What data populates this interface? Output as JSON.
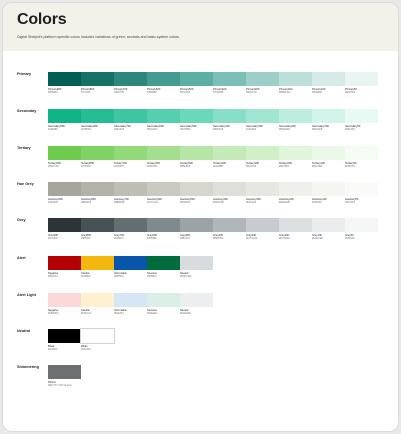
{
  "title": "Colors",
  "subtitle": "Digital Shelpid's platform specific colors includes variations of green, neutrals and basic system colors.",
  "groups": [
    {
      "label": "Primary",
      "swatches": [
        {
          "color": "#005e52",
          "name": "Primary900",
          "hex": "#005E52"
        },
        {
          "color": "#177266",
          "name": "Primary800",
          "hex": "#177266"
        },
        {
          "color": "#2e877b",
          "name": "Primary700",
          "hex": "#2E877B"
        },
        {
          "color": "#459b8f",
          "name": "Primary600",
          "hex": "#459B8F"
        },
        {
          "color": "#5cafa3",
          "name": "Primary500",
          "hex": "#5CAFA3"
        },
        {
          "color": "#7cbfb6",
          "name": "Primary400",
          "hex": "#7CBFB6"
        },
        {
          "color": "#9dcfc8",
          "name": "Primary300",
          "hex": "#9DCFC8"
        },
        {
          "color": "#bddfda",
          "name": "Primary200",
          "hex": "#BDDFDA"
        },
        {
          "color": "#d6ebe7",
          "name": "Primary100",
          "hex": "#D6EBE7"
        },
        {
          "color": "#eaf5f3",
          "name": "Primary50",
          "hex": "#EAF5F3"
        }
      ]
    },
    {
      "label": "Secondary",
      "swatches": [
        {
          "color": "#10b486",
          "name": "Secondary900",
          "hex": "#10B486"
        },
        {
          "color": "#27bd93",
          "name": "Secondary800",
          "hex": "#27BD93"
        },
        {
          "color": "#3ec6a0",
          "name": "Secondary700",
          "hex": "#3EC6A0"
        },
        {
          "color": "#55cfad",
          "name": "Secondary600",
          "hex": "#55CFAD"
        },
        {
          "color": "#6cd8ba",
          "name": "Secondary500",
          "hex": "#6CD8BA"
        },
        {
          "color": "#86dfc6",
          "name": "Secondary400",
          "hex": "#86DFC6"
        },
        {
          "color": "#a1e6d3",
          "name": "Secondary300",
          "hex": "#A1E6D3"
        },
        {
          "color": "#bcede0",
          "name": "Secondary200",
          "hex": "#BCEDE0"
        },
        {
          "color": "#d3f4eb",
          "name": "Secondary100",
          "hex": "#D3F4EB"
        },
        {
          "color": "#e9faf5",
          "name": "Secondary50",
          "hex": "#E9FAF5"
        }
      ]
    },
    {
      "label": "Tertiary",
      "swatches": [
        {
          "color": "#6dcc4d",
          "name": "Tertiary900",
          "hex": "#6DCC4D"
        },
        {
          "color": "#7fd263",
          "name": "Tertiary800",
          "hex": "#7FD263"
        },
        {
          "color": "#91d979",
          "name": "Tertiary700",
          "hex": "#91D979"
        },
        {
          "color": "#a3df8f",
          "name": "Tertiary600",
          "hex": "#A3DF8F"
        },
        {
          "color": "#b5e6a5",
          "name": "Tertiary500",
          "hex": "#B5E6A5"
        },
        {
          "color": "#c4ebb7",
          "name": "Tertiary400",
          "hex": "#C4EBB7"
        },
        {
          "color": "#d2f0c8",
          "name": "Tertiary300",
          "hex": "#D2F0C8"
        },
        {
          "color": "#e1f5da",
          "name": "Tertiary200",
          "hex": "#E1F5DA"
        },
        {
          "color": "#ecf9e8",
          "name": "Tertiary100",
          "hex": "#ECF9E8"
        },
        {
          "color": "#f5fcf3",
          "name": "Tertiary50",
          "hex": "#F5FCF3"
        }
      ]
    },
    {
      "label": "Hue Grey",
      "swatches": [
        {
          "color": "#a6a69c",
          "name": "HueGrey900",
          "hex": "#A6A69C"
        },
        {
          "color": "#b2b2a9",
          "name": "HueGrey800",
          "hex": "#B2B2A9"
        },
        {
          "color": "#bebeb5",
          "name": "HueGrey700",
          "hex": "#BEBEB5"
        },
        {
          "color": "#cacac2",
          "name": "HueGrey600",
          "hex": "#CACAC2"
        },
        {
          "color": "#d6d6cf",
          "name": "HueGrey500",
          "hex": "#D6D6CF"
        },
        {
          "color": "#dfdfd9",
          "name": "HueGrey400",
          "hex": "#DFDFD9"
        },
        {
          "color": "#e7e7e2",
          "name": "HueGrey300",
          "hex": "#E7E7E2"
        },
        {
          "color": "#efefeb",
          "name": "HueGrey200",
          "hex": "#EFEFEB"
        },
        {
          "color": "#f5f5f2",
          "name": "HueGrey100",
          "hex": "#F5F5F2"
        },
        {
          "color": "#fafaf8",
          "name": "HueGrey50",
          "hex": "#FAFAF8"
        }
      ]
    },
    {
      "label": "Grey",
      "swatches": [
        {
          "color": "#2c3438",
          "name": "Grey900",
          "hex": "#2C3438"
        },
        {
          "color": "#485156",
          "name": "Grey800",
          "hex": "#485156"
        },
        {
          "color": "#646d72",
          "name": "Grey700",
          "hex": "#646D72"
        },
        {
          "color": "#80898e",
          "name": "Grey600",
          "hex": "#80898E"
        },
        {
          "color": "#9ba3a7",
          "name": "Grey500",
          "hex": "#9BA3A7"
        },
        {
          "color": "#b0b7ba",
          "name": "Grey400",
          "hex": "#B0B7BA"
        },
        {
          "color": "#c7ccce",
          "name": "Grey300",
          "hex": "#C7CCCE"
        },
        {
          "color": "#dcdfe0",
          "name": "Grey200",
          "hex": "#DCDFE0"
        },
        {
          "color": "#eaeced",
          "name": "Grey100",
          "hex": "#EAECED"
        },
        {
          "color": "#f5f6f6",
          "name": "Grey50",
          "hex": "#F5F6F6"
        }
      ]
    },
    {
      "label": "Alert",
      "swatches": [
        {
          "color": "#b30000",
          "name": "Negative",
          "hex": "#B30000"
        },
        {
          "color": "#f2b80f",
          "name": "Caution",
          "hex": "#F2B80F"
        },
        {
          "color": "#0855a9",
          "name": "Information",
          "hex": "#0855A9"
        },
        {
          "color": "#006b3c",
          "name": "Success",
          "hex": "#006B3C"
        },
        {
          "color": "#d9dcde",
          "name": "Neutral",
          "hex": "#D9DCDE"
        }
      ]
    },
    {
      "label": "Alert Light",
      "swatches": [
        {
          "color": "#fbd9d9",
          "name": "Negative",
          "hex": "#FBD9D9"
        },
        {
          "color": "#fdf1cf",
          "name": "Caution",
          "hex": "#FDF1CF"
        },
        {
          "color": "#d6e6f7",
          "name": "Information",
          "hex": "#D6E6F7"
        },
        {
          "color": "#d9eee4",
          "name": "Success",
          "hex": "#D9EEE4"
        },
        {
          "color": "#eceeef",
          "name": "Neutral",
          "hex": "#ECEEEF"
        }
      ]
    },
    {
      "label": "Neutral",
      "swatches": [
        {
          "color": "#000000",
          "name": "Black",
          "hex": "#000000"
        },
        {
          "color": "#ffffff",
          "name": "White",
          "hex": "#FFFFFF"
        }
      ]
    },
    {
      "label": "Shimmering",
      "swatches": [
        {
          "color": "#6e7173",
          "name": "Shimm",
          "hex": "#6E7173 70% Opacity"
        }
      ]
    }
  ]
}
